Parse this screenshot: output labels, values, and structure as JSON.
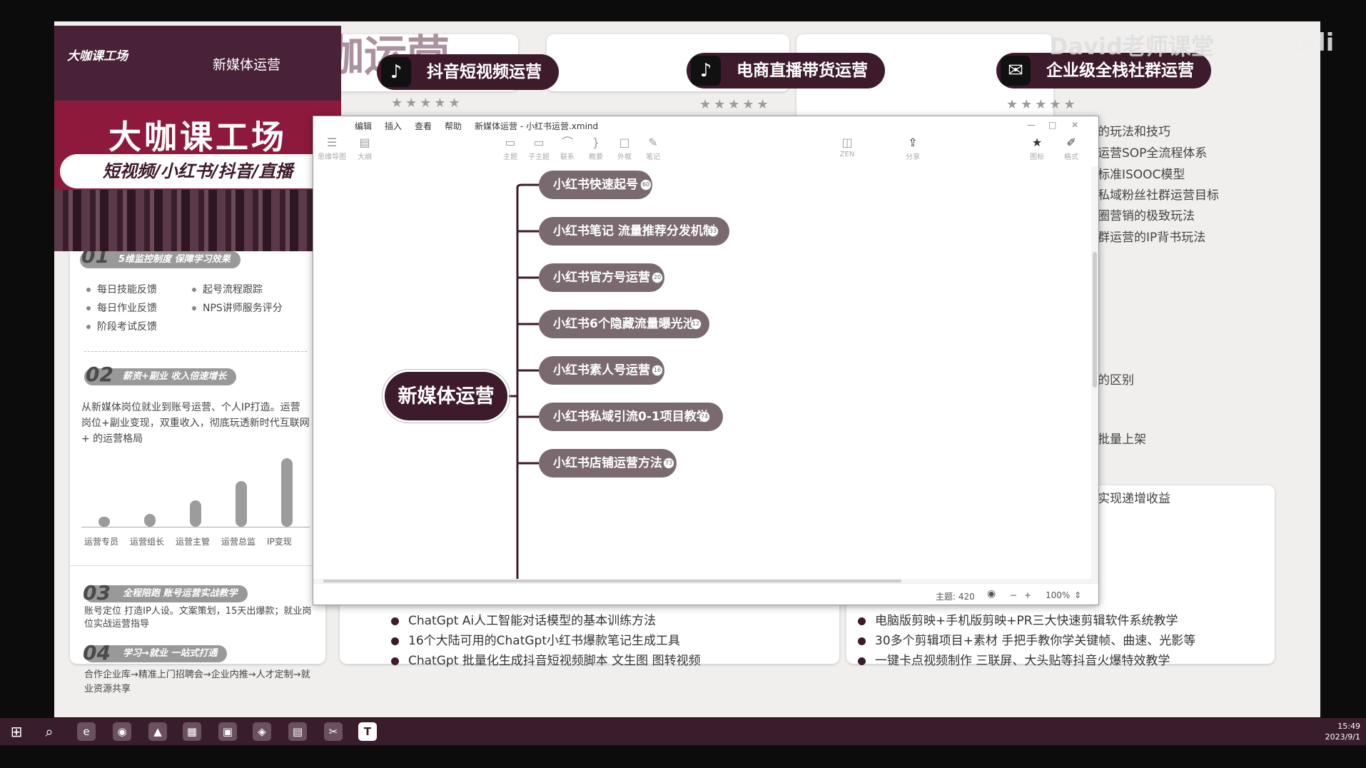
{
  "banner": {
    "logo": "大咖课工场",
    "subtitle": "新媒体运营",
    "title": "大咖课工场",
    "pill": "短视频/小红书/抖音/直播"
  },
  "ghost_text": "大咖运营",
  "watermark": {
    "text": "David老师课堂",
    "bili": "bili"
  },
  "courses": [
    {
      "icon": "tiktok-icon",
      "glyph": "♪",
      "title": "抖音短视频运营",
      "stars": "★★★★★"
    },
    {
      "icon": "tiktok-icon",
      "glyph": "♪",
      "title": "电商直播带货运营",
      "stars": "★★★★★"
    },
    {
      "icon": "wechat-icon",
      "glyph": "✉",
      "title": "企业级全栈社群运营",
      "stars": "★★★★★"
    }
  ],
  "right_card": {
    "lines": [
      "的玩法和技巧",
      "运营SOP全流程体系",
      "标准ISOOC模型",
      "私域粉丝社群运营目标",
      "圈营销的极致玩法",
      "群运营的IP背书玩法"
    ],
    "mid": [
      "的区别",
      "批量上架",
      "实现递增收益"
    ]
  },
  "left_card": {
    "s1": {
      "num": "01",
      "label": "5维监控制度 保障学习效果",
      "items": [
        "每日技能反馈",
        "每日作业反馈",
        "阶段考试反馈",
        "起号流程跟踪",
        "NPS讲师服务评分"
      ]
    },
    "s2": {
      "num": "02",
      "label": "薪资+副业 收入倍速增长",
      "text": "从新媒体岗位就业到账号运营、个人IP打造。运营岗位+副业变现，双重收入，彻底玩透新时代互联网+ 的运营格局"
    },
    "chart_data": {
      "type": "bar",
      "categories": [
        "运营专员",
        "运营组长",
        "运营主管",
        "运营总监",
        "IP变现"
      ],
      "values": [
        1,
        1.5,
        3,
        5.2,
        7.8
      ]
    },
    "s3": {
      "num": "03",
      "label": "全程陪跑 账号运营实战教学",
      "text": "账号定位 打造IP人设。文案策划，15天出爆款；就业岗位实战运营指导"
    },
    "s4": {
      "num": "04",
      "label": "学习→就业 一站式打通",
      "text": "合作企业库→精准上门招聘会→企业内推→人才定制→就业资源共享"
    }
  },
  "bottom_left": [
    "ChatGpt Ai人工智能对话模型的基本训练方法",
    "16个大陆可用的ChatGpt小红书爆款笔记生成工具",
    "ChatGpt 批量化生成抖音短视频脚本 文生图 图转视频"
  ],
  "bottom_right": [
    "电脑版剪映+手机版剪映+PR三大快速剪辑软件系统教学",
    "30多个剪辑项目+素材 手把手教你学关键帧、曲速、光影等",
    "一键卡点视频制作 三联屏、大头贴等抖音火爆特效教学"
  ],
  "xmind": {
    "menu": [
      "编辑",
      "插入",
      "查看",
      "帮助"
    ],
    "doc_title": "新媒体运营 - 小红书运营.xmind",
    "win_controls": [
      "—",
      "□",
      "✕"
    ],
    "tools": [
      {
        "g": "☰",
        "l": "思维导图"
      },
      {
        "g": "▤",
        "l": "大纲"
      },
      {
        "g": "▭",
        "l": "主题"
      },
      {
        "g": "▭",
        "l": "子主题"
      },
      {
        "g": "⌒",
        "l": "联系"
      },
      {
        "g": "}",
        "l": "概要"
      },
      {
        "g": "□",
        "l": "外框"
      },
      {
        "g": "✎",
        "l": "笔记"
      },
      {
        "g": "◫",
        "l": "ZEN"
      },
      {
        "g": "⇪",
        "l": "分享"
      },
      {
        "g": "★",
        "l": "图标"
      },
      {
        "g": "✐",
        "l": "格式"
      }
    ],
    "root": "新媒体运营",
    "nodes": [
      {
        "label": "小红书快速起号",
        "badge": "60"
      },
      {
        "label": "小红书笔记 流量推荐分发机制",
        "badge": "33"
      },
      {
        "label": "小红书官方号运营",
        "badge": "20"
      },
      {
        "label": "小红书6个隐藏流量曝光池",
        "badge": "12"
      },
      {
        "label": "小红书素人号运营",
        "badge": "16"
      },
      {
        "label": "小红书私域引流0-1项目教学",
        "badge": "74"
      },
      {
        "label": "小红书店铺运营方法",
        "badge": "73"
      }
    ],
    "status": {
      "topics": "主题: 420",
      "zoom": "100%"
    }
  },
  "taskbar": {
    "icons": [
      "⊞",
      "⌕",
      "e",
      "◉",
      "▲",
      "▦",
      "▣",
      "◈",
      "▤",
      "✂",
      "T"
    ],
    "time": "15:49",
    "date": "2023/9/1"
  }
}
